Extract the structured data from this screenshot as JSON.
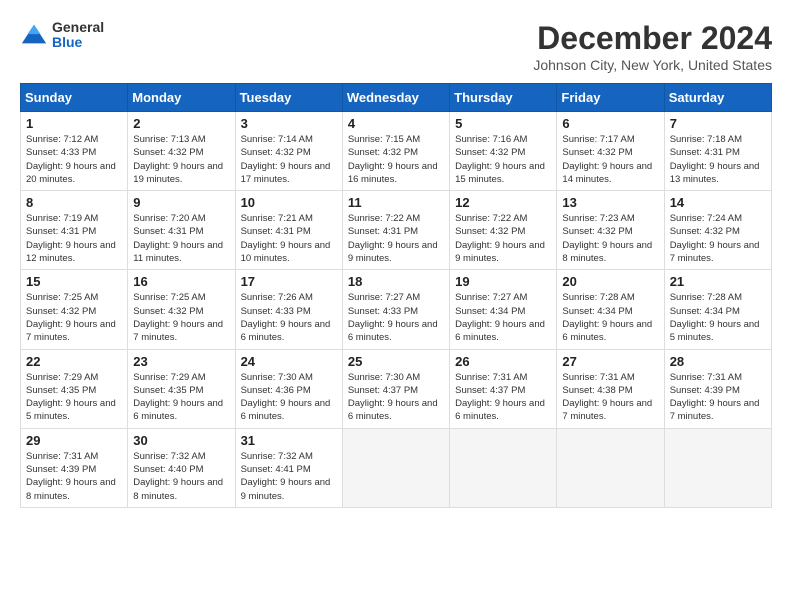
{
  "header": {
    "logo_general": "General",
    "logo_blue": "Blue",
    "month_title": "December 2024",
    "location": "Johnson City, New York, United States"
  },
  "weekdays": [
    "Sunday",
    "Monday",
    "Tuesday",
    "Wednesday",
    "Thursday",
    "Friday",
    "Saturday"
  ],
  "weeks": [
    [
      {
        "day": "1",
        "sunrise": "7:12 AM",
        "sunset": "4:33 PM",
        "daylight": "9 hours and 20 minutes."
      },
      {
        "day": "2",
        "sunrise": "7:13 AM",
        "sunset": "4:32 PM",
        "daylight": "9 hours and 19 minutes."
      },
      {
        "day": "3",
        "sunrise": "7:14 AM",
        "sunset": "4:32 PM",
        "daylight": "9 hours and 17 minutes."
      },
      {
        "day": "4",
        "sunrise": "7:15 AM",
        "sunset": "4:32 PM",
        "daylight": "9 hours and 16 minutes."
      },
      {
        "day": "5",
        "sunrise": "7:16 AM",
        "sunset": "4:32 PM",
        "daylight": "9 hours and 15 minutes."
      },
      {
        "day": "6",
        "sunrise": "7:17 AM",
        "sunset": "4:32 PM",
        "daylight": "9 hours and 14 minutes."
      },
      {
        "day": "7",
        "sunrise": "7:18 AM",
        "sunset": "4:31 PM",
        "daylight": "9 hours and 13 minutes."
      }
    ],
    [
      {
        "day": "8",
        "sunrise": "7:19 AM",
        "sunset": "4:31 PM",
        "daylight": "9 hours and 12 minutes."
      },
      {
        "day": "9",
        "sunrise": "7:20 AM",
        "sunset": "4:31 PM",
        "daylight": "9 hours and 11 minutes."
      },
      {
        "day": "10",
        "sunrise": "7:21 AM",
        "sunset": "4:31 PM",
        "daylight": "9 hours and 10 minutes."
      },
      {
        "day": "11",
        "sunrise": "7:22 AM",
        "sunset": "4:31 PM",
        "daylight": "9 hours and 9 minutes."
      },
      {
        "day": "12",
        "sunrise": "7:22 AM",
        "sunset": "4:32 PM",
        "daylight": "9 hours and 9 minutes."
      },
      {
        "day": "13",
        "sunrise": "7:23 AM",
        "sunset": "4:32 PM",
        "daylight": "9 hours and 8 minutes."
      },
      {
        "day": "14",
        "sunrise": "7:24 AM",
        "sunset": "4:32 PM",
        "daylight": "9 hours and 7 minutes."
      }
    ],
    [
      {
        "day": "15",
        "sunrise": "7:25 AM",
        "sunset": "4:32 PM",
        "daylight": "9 hours and 7 minutes."
      },
      {
        "day": "16",
        "sunrise": "7:25 AM",
        "sunset": "4:32 PM",
        "daylight": "9 hours and 7 minutes."
      },
      {
        "day": "17",
        "sunrise": "7:26 AM",
        "sunset": "4:33 PM",
        "daylight": "9 hours and 6 minutes."
      },
      {
        "day": "18",
        "sunrise": "7:27 AM",
        "sunset": "4:33 PM",
        "daylight": "9 hours and 6 minutes."
      },
      {
        "day": "19",
        "sunrise": "7:27 AM",
        "sunset": "4:34 PM",
        "daylight": "9 hours and 6 minutes."
      },
      {
        "day": "20",
        "sunrise": "7:28 AM",
        "sunset": "4:34 PM",
        "daylight": "9 hours and 6 minutes."
      },
      {
        "day": "21",
        "sunrise": "7:28 AM",
        "sunset": "4:34 PM",
        "daylight": "9 hours and 5 minutes."
      }
    ],
    [
      {
        "day": "22",
        "sunrise": "7:29 AM",
        "sunset": "4:35 PM",
        "daylight": "9 hours and 5 minutes."
      },
      {
        "day": "23",
        "sunrise": "7:29 AM",
        "sunset": "4:35 PM",
        "daylight": "9 hours and 6 minutes."
      },
      {
        "day": "24",
        "sunrise": "7:30 AM",
        "sunset": "4:36 PM",
        "daylight": "9 hours and 6 minutes."
      },
      {
        "day": "25",
        "sunrise": "7:30 AM",
        "sunset": "4:37 PM",
        "daylight": "9 hours and 6 minutes."
      },
      {
        "day": "26",
        "sunrise": "7:31 AM",
        "sunset": "4:37 PM",
        "daylight": "9 hours and 6 minutes."
      },
      {
        "day": "27",
        "sunrise": "7:31 AM",
        "sunset": "4:38 PM",
        "daylight": "9 hours and 7 minutes."
      },
      {
        "day": "28",
        "sunrise": "7:31 AM",
        "sunset": "4:39 PM",
        "daylight": "9 hours and 7 minutes."
      }
    ],
    [
      {
        "day": "29",
        "sunrise": "7:31 AM",
        "sunset": "4:39 PM",
        "daylight": "9 hours and 8 minutes."
      },
      {
        "day": "30",
        "sunrise": "7:32 AM",
        "sunset": "4:40 PM",
        "daylight": "9 hours and 8 minutes."
      },
      {
        "day": "31",
        "sunrise": "7:32 AM",
        "sunset": "4:41 PM",
        "daylight": "9 hours and 9 minutes."
      },
      null,
      null,
      null,
      null
    ]
  ]
}
